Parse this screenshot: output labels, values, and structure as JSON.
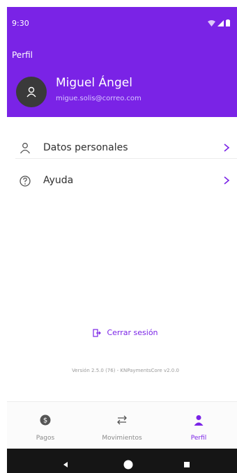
{
  "status_bar": {
    "time": "9:30"
  },
  "header": {
    "title": "Perfil",
    "user_name": "Miguel Ángel",
    "user_email": "migue.solis@correo.com"
  },
  "menu": {
    "items": [
      {
        "label": "Datos personales",
        "icon": "person-outline-icon"
      },
      {
        "label": "Ayuda",
        "icon": "help-circle-icon"
      }
    ]
  },
  "footer": {
    "logout_label": "Cerrar sesión",
    "version": "Versión 2.5.0 (76) - KNPaymentsCore v2.0.0"
  },
  "bottom_nav": {
    "tabs": [
      {
        "label": "Pagos",
        "icon": "dollar-coin-icon",
        "active": false
      },
      {
        "label": "Movimientos",
        "icon": "swap-arrows-icon",
        "active": false
      },
      {
        "label": "Perfil",
        "icon": "person-icon",
        "active": true
      }
    ]
  },
  "colors": {
    "primary": "#7a23e6",
    "header_bg": "#7a23e6",
    "text": "#2f2f2f",
    "muted": "#8a8a8a"
  }
}
